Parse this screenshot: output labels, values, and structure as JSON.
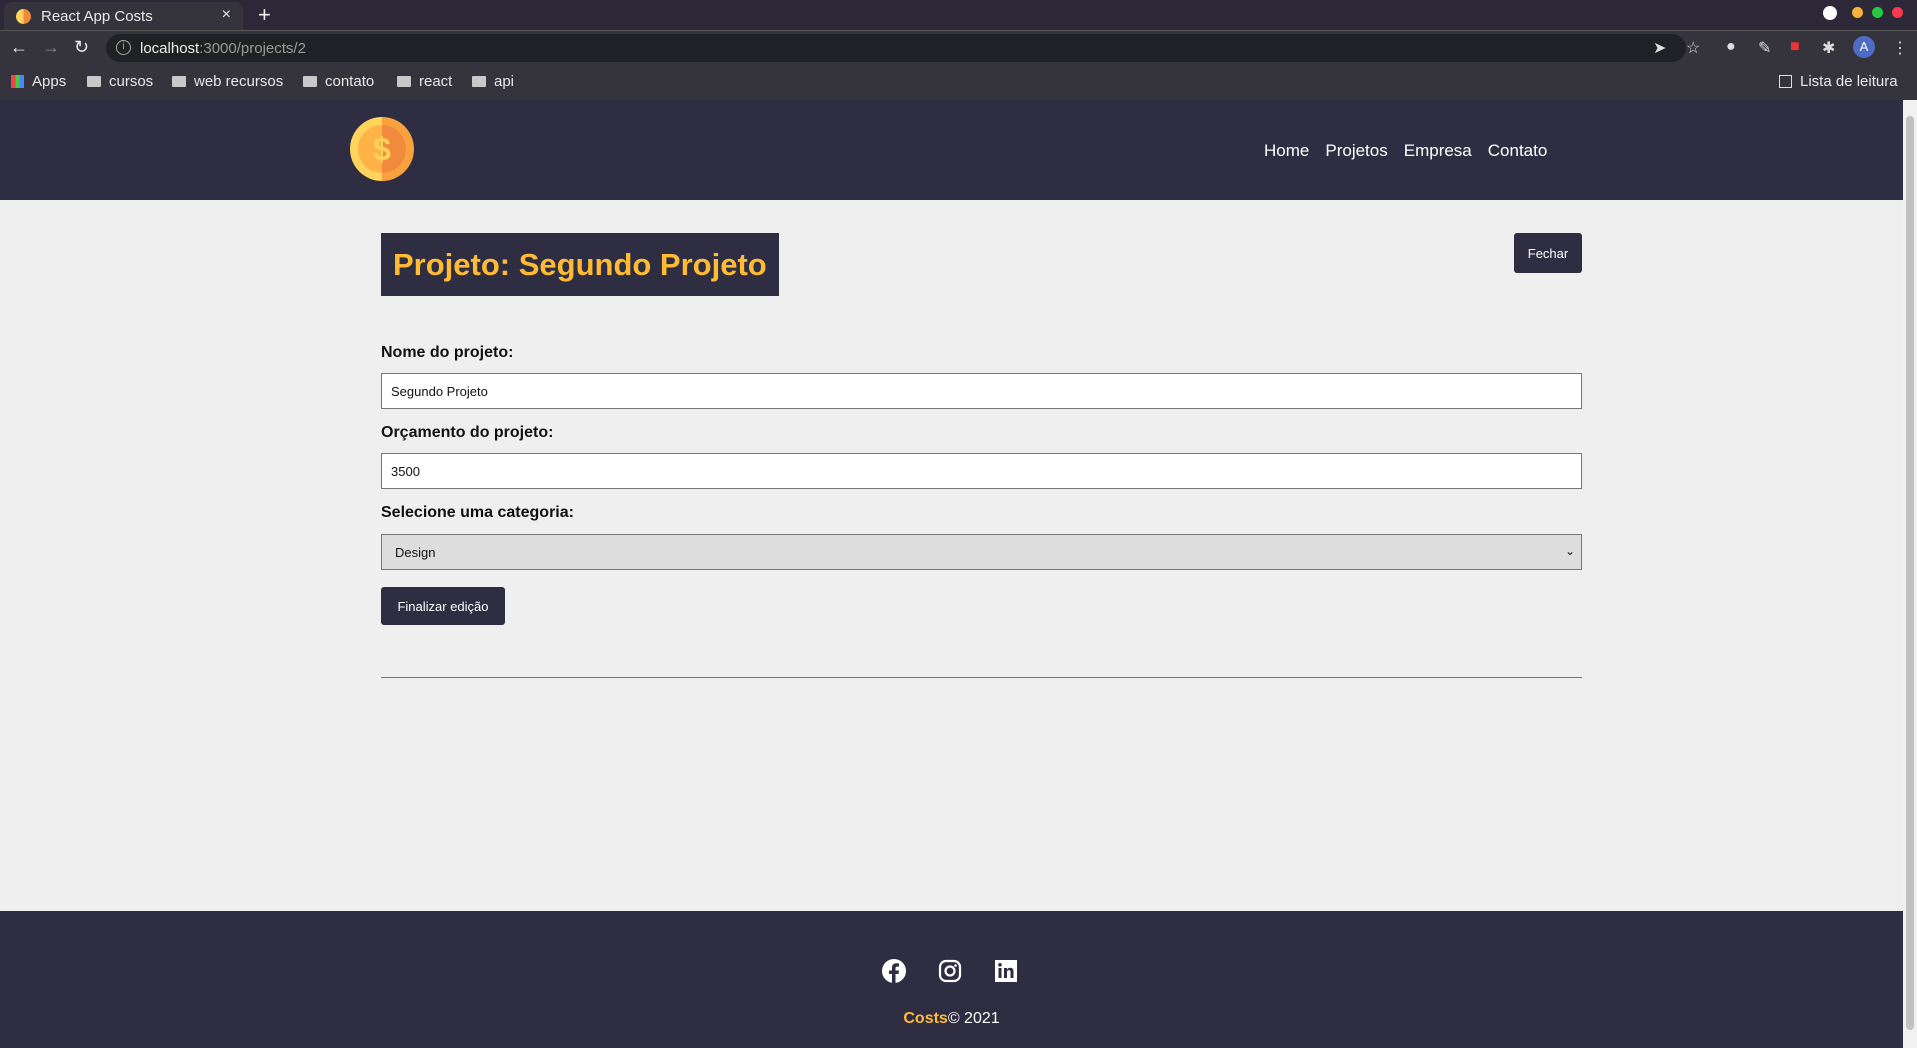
{
  "browser": {
    "tab_title": "React App Costs",
    "url_host": "localhost",
    "url_path": ":3000/projects/2",
    "bookmarks": [
      "Apps",
      "cursos",
      "web recursos",
      "contato",
      "react",
      "api"
    ],
    "reading_list": "Lista de leitura",
    "profile_initial": "A"
  },
  "nav": {
    "links": [
      "Home",
      "Projetos",
      "Empresa",
      "Contato"
    ]
  },
  "page": {
    "title": "Projeto: Segundo Projeto",
    "close_label": "Fechar"
  },
  "form": {
    "name_label": "Nome do projeto:",
    "name_value": "Segundo Projeto",
    "budget_label": "Orçamento do projeto:",
    "budget_value": "3500",
    "category_label": "Selecione uma categoria:",
    "category_value": "Design",
    "submit_label": "Finalizar edição"
  },
  "footer": {
    "brand": "Costs",
    "copyright": "© 2021"
  },
  "colors": {
    "primary": "#2f2d42",
    "accent": "#ffbb33",
    "background": "#efefef"
  }
}
